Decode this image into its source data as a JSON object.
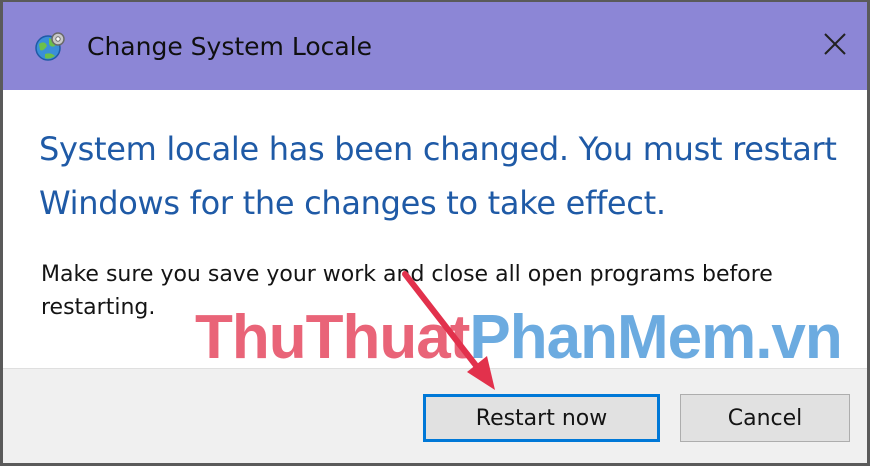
{
  "dialog": {
    "title": "Change System Locale",
    "icon": "globe-gear-icon",
    "close_glyph": "✕"
  },
  "content": {
    "main_instruction": "System locale has been changed. You must restart Windows for the changes to take effect.",
    "sub_text": "Make sure you save your work and close all open programs before restarting."
  },
  "footer": {
    "restart_label": "Restart now",
    "cancel_label": "Cancel"
  },
  "watermark": {
    "part1": "ThuThuat",
    "part2": "PhanMem.vn"
  },
  "colors": {
    "titlebar": "#8c86d6",
    "instruction_text": "#1f5aa6",
    "primary_border": "#0078d7",
    "arrow": "#e2314c"
  }
}
